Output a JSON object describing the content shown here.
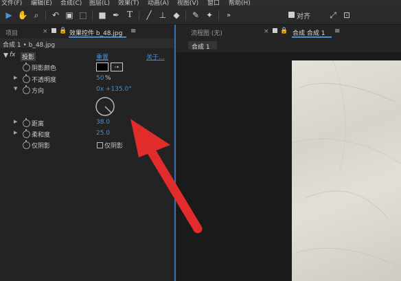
{
  "menubar": {
    "items": [
      "文件(F)",
      "编辑(E)",
      "合成(C)",
      "图层(L)",
      "效果(T)",
      "动画(A)",
      "视图(V)",
      "窗口",
      "帮助(H)"
    ]
  },
  "toolbar": {
    "snap_label": "对齐"
  },
  "left_panel": {
    "tab_project": "项目",
    "tab_effect_controls": "效果控件 b_48.jpg",
    "breadcrumb": "合成 1 • b_48.jpg",
    "fx_label": "fx",
    "effect_name": "投影",
    "reset_label": "重置",
    "about_label": "关于...",
    "properties": {
      "shadow_color": "阴影颜色",
      "opacity": "不透明度",
      "opacity_value": "50",
      "opacity_unit": "%",
      "direction": "方向",
      "direction_value": "0x +135.0°",
      "distance": "距离",
      "distance_value": "38.0",
      "softness": "柔和度",
      "softness_value": "25.0",
      "shadow_only": "仅阴影",
      "shadow_only_checkbox_label": "仅阴影"
    }
  },
  "right_panel": {
    "tab_flowchart": "流程图 (无)",
    "tab_comp": "合成 合成 1",
    "comp_subtab": "合成 1"
  },
  "colors": {
    "accent": "#4b8fd6",
    "arrow": "#e22b2b",
    "panel_bg": "#232323",
    "highlight": "#3b6fb0"
  }
}
